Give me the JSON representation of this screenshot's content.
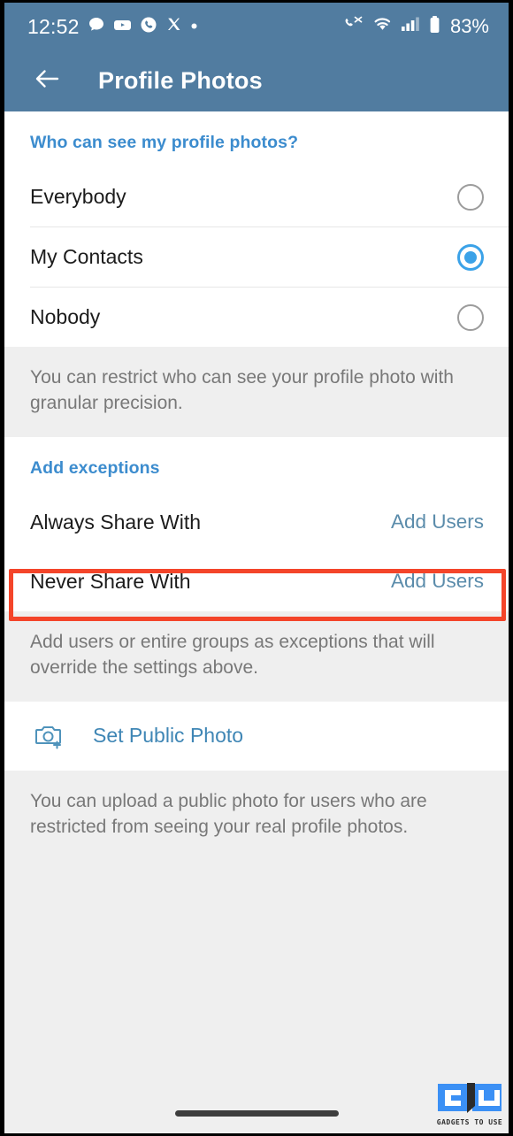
{
  "theme": {
    "header_bg": "#517ca0",
    "accent_blue": "#3c8cce",
    "link_blue": "#5b8cab",
    "radio_on": "#3ba2e8",
    "highlight_red": "#f4452a",
    "page_bg": "#efefef"
  },
  "statusbar": {
    "time": "12:52",
    "left_icons": [
      "chat-bubble-icon",
      "youtube-icon",
      "phone-circle-icon",
      "x-twitter-icon",
      "dot-icon"
    ],
    "right_icons": [
      "call-mute-icon",
      "wifi-icon",
      "cellular-signal-icon",
      "battery-icon"
    ],
    "battery_percent": "83%"
  },
  "appbar": {
    "back_icon": "back-arrow-icon",
    "title": "Profile Photos"
  },
  "visibility": {
    "heading": "Who can see my profile photos?",
    "options": [
      {
        "label": "Everybody",
        "selected": false
      },
      {
        "label": "My Contacts",
        "selected": true
      },
      {
        "label": "Nobody",
        "selected": false
      }
    ],
    "note": "You can restrict who can see your profile photo with granular precision."
  },
  "exceptions": {
    "heading": "Add exceptions",
    "rows": [
      {
        "label": "Always Share With",
        "action": "Add Users",
        "highlighted": true
      },
      {
        "label": "Never Share With",
        "action": "Add Users",
        "highlighted": false
      }
    ],
    "note": "Add users or entire groups as exceptions that will override the settings above."
  },
  "public_photo": {
    "icon": "camera-add-icon",
    "label": "Set Public Photo",
    "note": "You can upload a public photo for users who are restricted from seeing your real profile photos."
  },
  "watermark": {
    "text": "GADGETS TO USE",
    "icon": "gadgets-to-use-logo"
  },
  "navbar": {
    "gesture_handle": "home-gesture-pill"
  }
}
